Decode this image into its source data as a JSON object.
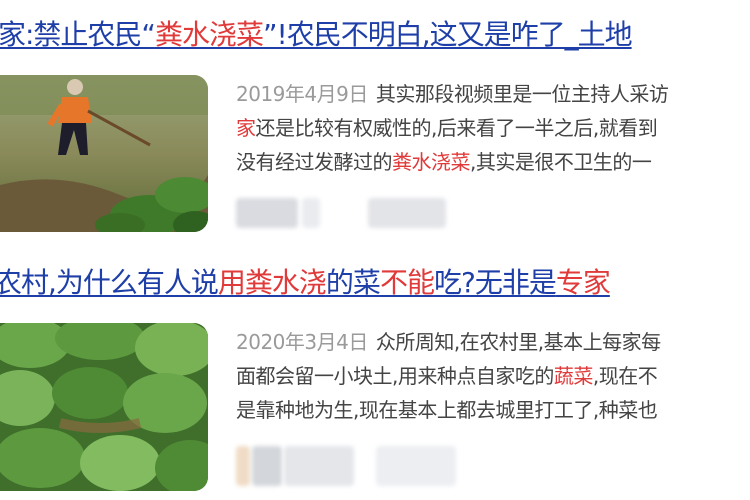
{
  "results": [
    {
      "title_parts": [
        "家:禁止农民“",
        "粪水浇菜",
        "”!农民不明白,这又是咋了_土地"
      ],
      "date": "2019年4月9日",
      "snippet": {
        "line1": "其实那段视频里是一位主持人采访",
        "line2_red": "家",
        "line2_rest": "还是比较有权威性的,后来看了一半之后,就看到",
        "line3_a": "没有经过发酵过的",
        "line3_red": "粪水浇菜",
        "line3_b": ",其实是很不卫生的一"
      }
    },
    {
      "title_parts": [
        "农村,为什么有人说",
        "用粪水浇",
        "的菜",
        "不能",
        "吃?无非是",
        "专家"
      ],
      "date": "2020年3月4日",
      "snippet": {
        "line1": "众所周知,在农村里,基本上每家每",
        "line2_a": "面都会留一小块土,用来种点自家吃的",
        "line2_red": "蔬菜",
        "line2_b": ",现在不",
        "line3": "是靠种地为生,现在基本上都去城里打工了,种菜也"
      }
    }
  ]
}
